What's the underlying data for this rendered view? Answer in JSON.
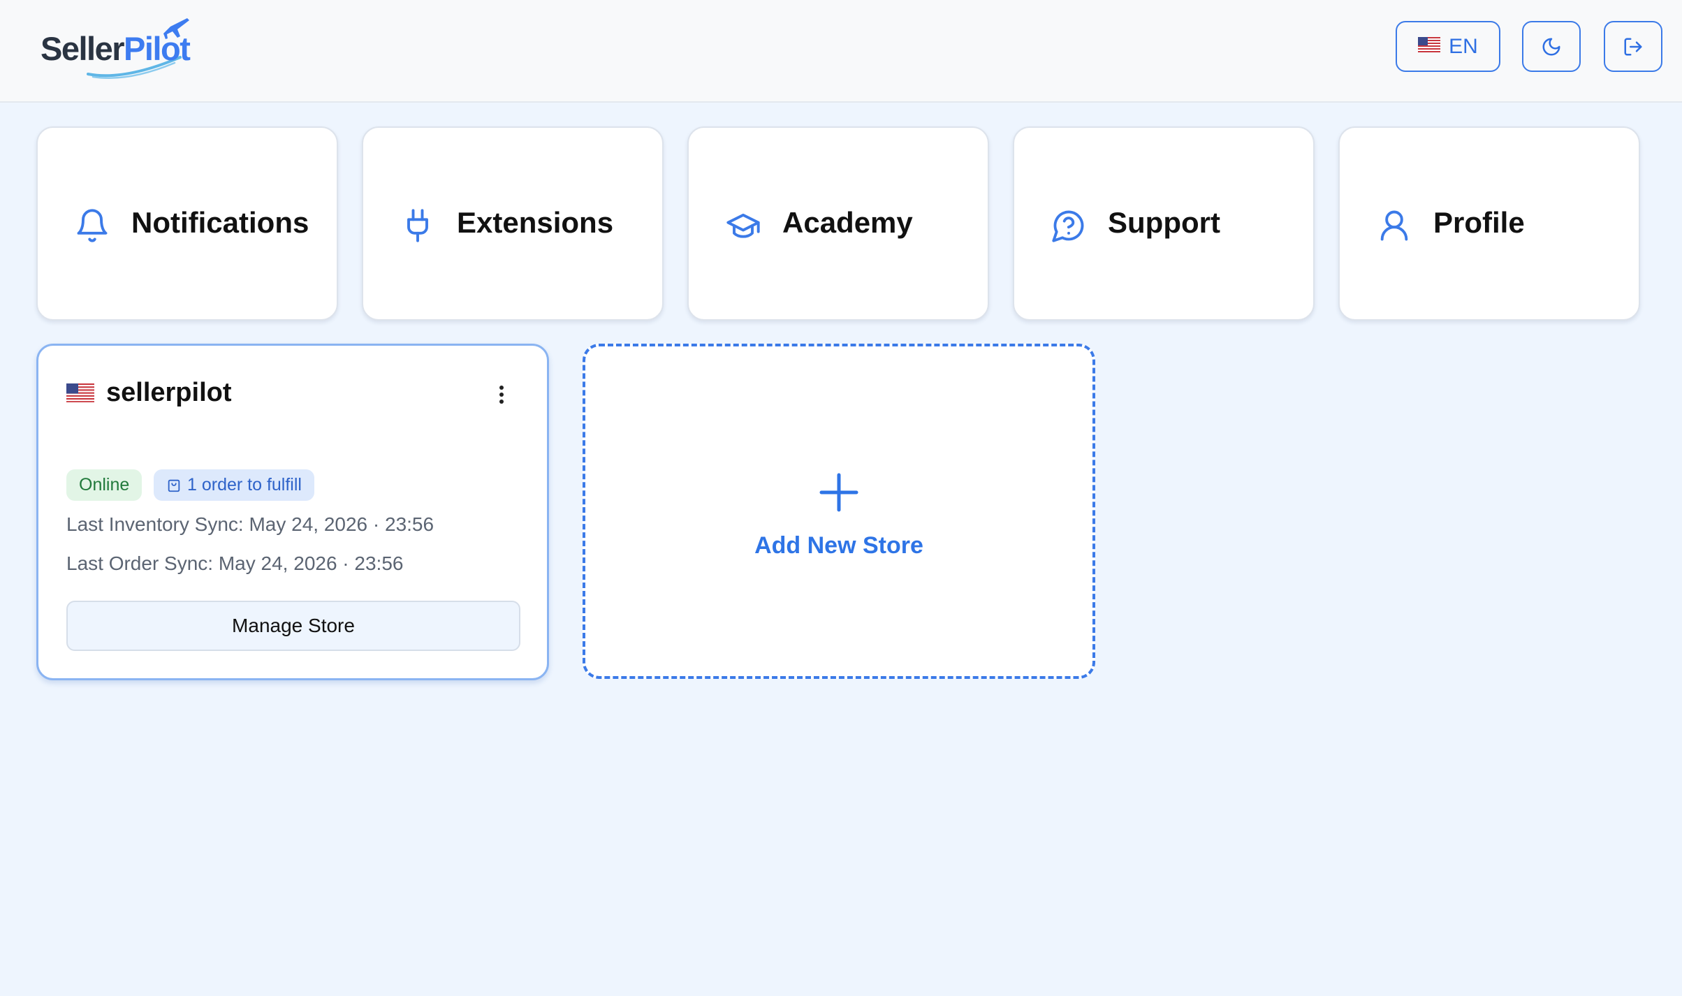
{
  "header": {
    "logo": {
      "part1": "Seller",
      "part2": "Pilot"
    },
    "language_button": {
      "label": "EN",
      "flag_icon": "us-flag-icon"
    },
    "theme_button_icon": "moon-icon",
    "logout_button_icon": "logout-icon"
  },
  "nav_cards": [
    {
      "label": "Notifications",
      "icon": "bell-icon"
    },
    {
      "label": "Extensions",
      "icon": "plug-icon"
    },
    {
      "label": "Academy",
      "icon": "graduation-cap-icon"
    },
    {
      "label": "Support",
      "icon": "help-bubble-icon"
    },
    {
      "label": "Profile",
      "icon": "user-icon"
    }
  ],
  "store": {
    "name": "sellerpilot",
    "flag_icon": "us-flag-icon",
    "status_badge": "Online",
    "orders_badge": "1 order to fulfill",
    "last_inventory_sync": "Last Inventory Sync: May 24, 2026 · 23:56",
    "last_order_sync": "Last Order Sync: May 24, 2026 · 23:56",
    "manage_label": "Manage Store"
  },
  "add_store": {
    "label": "Add New Store",
    "icon": "plus-icon"
  },
  "colors": {
    "accent": "#3b7ae8",
    "background": "#eef5fe",
    "online_badge_bg": "#e2f5e6",
    "order_badge_bg": "#dde9fc"
  }
}
